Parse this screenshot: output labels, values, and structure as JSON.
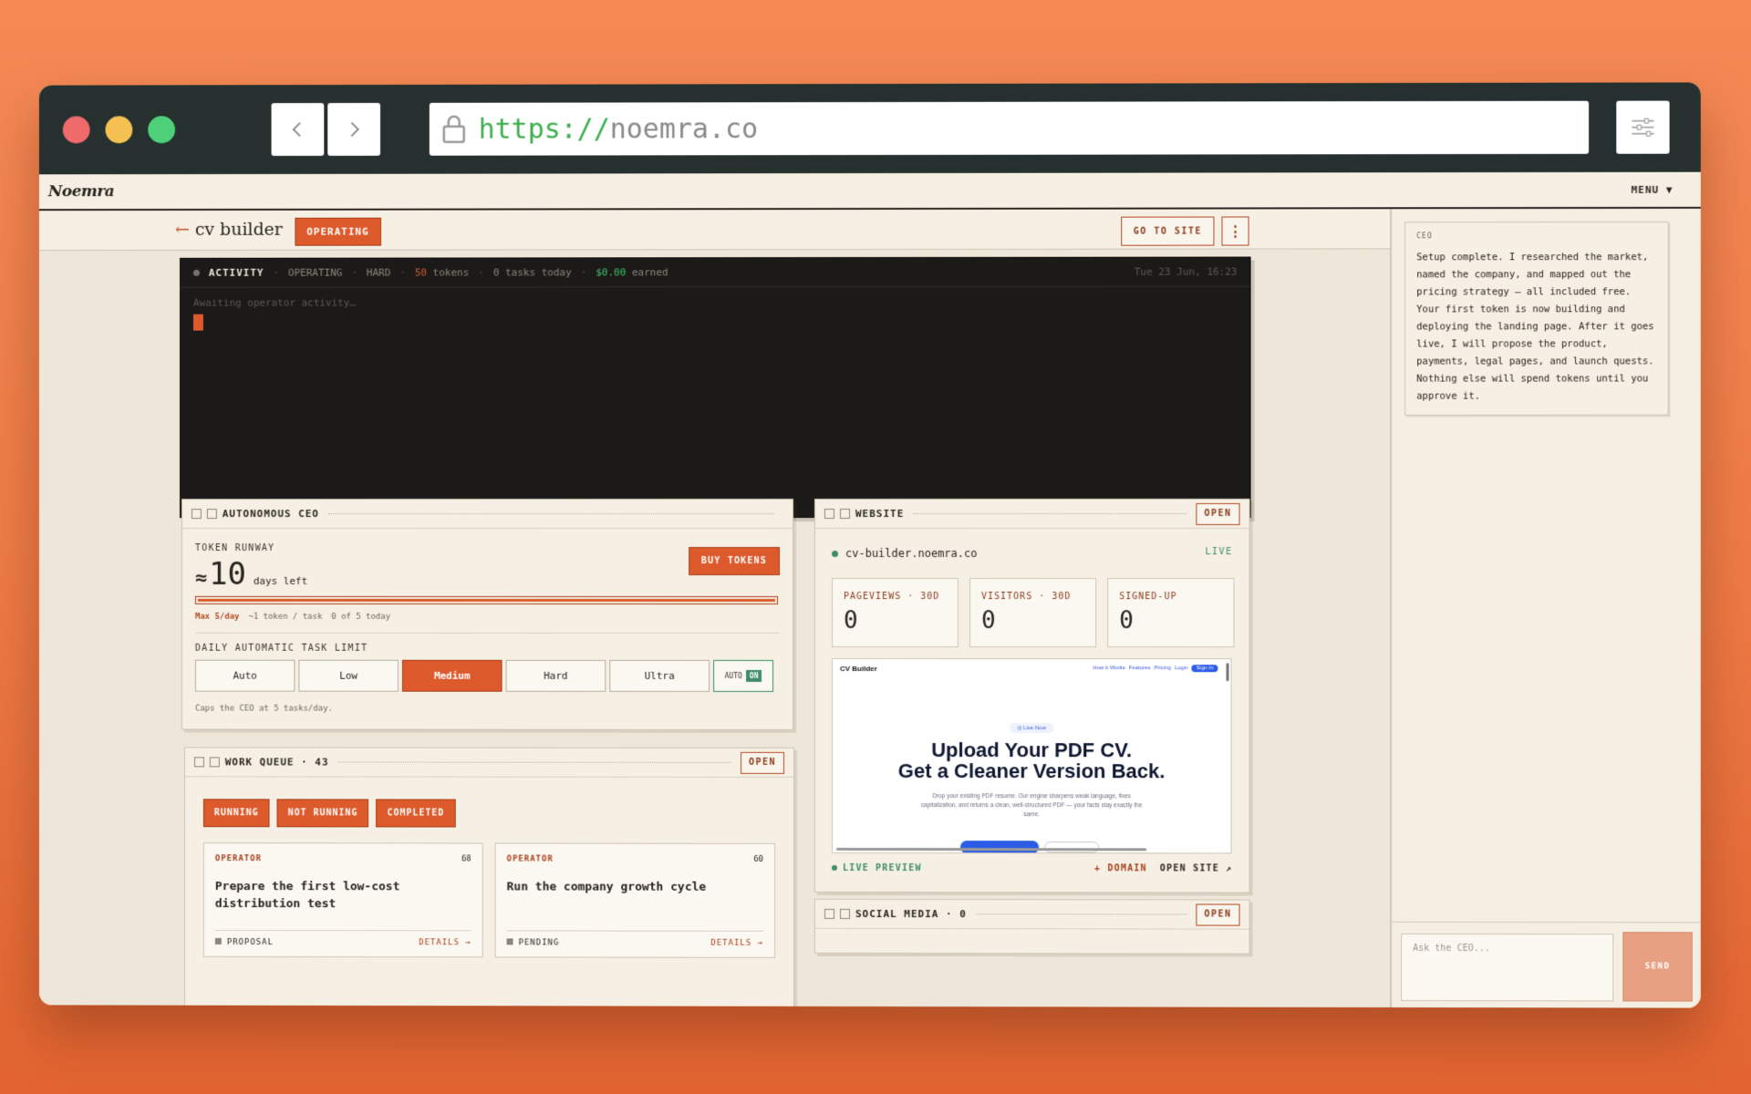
{
  "browser": {
    "url_scheme": "https://",
    "url_host": "noemra.co"
  },
  "app": {
    "brand": "Noemra",
    "menu_label": "MENU ▼"
  },
  "project": {
    "back_arrow": "←",
    "name": "cv builder",
    "status_badge": "OPERATING",
    "goto_label": "GO TO SITE",
    "kebab": "⋮"
  },
  "activity": {
    "label": "ACTIVITY",
    "status": "OPERATING",
    "difficulty": "HARD",
    "tokens_num": "50",
    "tokens_word": "tokens",
    "tasks_today": "0 tasks today",
    "earned_amount": "$0.00",
    "earned_word": "earned",
    "timestamp": "Tue 23 Jun, 16:23",
    "placeholder": "Awaiting operator activity…",
    "sep": "·"
  },
  "ceo_card": {
    "title": "AUTONOMOUS CEO",
    "runway_label": "TOKEN RUNWAY",
    "approx": "≈",
    "runway_value": "10",
    "runway_unit": "days left",
    "buy_label": "BUY TOKENS",
    "runway_fill_percent": 100,
    "max_label": "Max 5/day",
    "per_task": "~1 token / task",
    "today": "0 of 5 today",
    "limit_label": "DAILY AUTOMATIC TASK LIMIT",
    "levels": [
      "Auto",
      "Low",
      "Medium",
      "Hard",
      "Ultra"
    ],
    "active_level": "Medium",
    "auto_label": "AUTO",
    "auto_state": "ON",
    "caps_text": "Caps the CEO at 5 tasks/day."
  },
  "work_queue": {
    "title": "WORK QUEUE · 43",
    "open_label": "OPEN",
    "filters": [
      "RUNNING",
      "NOT RUNNING",
      "COMPLETED"
    ],
    "tasks": [
      {
        "role": "OPERATOR",
        "count": "68",
        "title": "Prepare the first low-cost distribution test",
        "status": "PROPOSAL",
        "details": "DETAILS →"
      },
      {
        "role": "OPERATOR",
        "count": "60",
        "title": "Run the company growth cycle",
        "status": "PENDING",
        "details": "DETAILS →"
      }
    ]
  },
  "website": {
    "title": "WEBSITE",
    "open_label": "OPEN",
    "domain": "cv-builder.noemra.co",
    "live": "LIVE",
    "stats": [
      {
        "label": "PAGEVIEWS · 30D",
        "value": "0"
      },
      {
        "label": "VISITORS · 30D",
        "value": "0"
      },
      {
        "label": "SIGNED-UP",
        "value": "0"
      }
    ],
    "preview": {
      "logo": "CV Builder",
      "nav": [
        "How it Works",
        "Features",
        "Pricing",
        "Login"
      ],
      "nav_cta": "Sign In",
      "badge": "◎ Live Now",
      "headline_1": "Upload Your PDF CV.",
      "headline_2": "Get a Cleaner Version Back.",
      "paragraph": "Drop your existing PDF resume. Our engine sharpens weak language, fixes capitalization, and returns a clean, well-structured PDF — your facts stay exactly the same."
    },
    "live_preview": "LIVE PREVIEW",
    "domain_link": "+ DOMAIN",
    "open_site": "OPEN SITE ↗"
  },
  "social": {
    "title": "SOCIAL MEDIA · 0",
    "open_label": "OPEN"
  },
  "ceo_panel": {
    "who": "CEO",
    "message": "Setup complete. I researched the market, named the company, and mapped out the pricing strategy — all included free. Your first token is now building and deploying the landing page. After it goes live, I will propose the product, payments, legal pages, and launch quests. Nothing else will spend tokens until you approve it.",
    "ask_placeholder": "Ask the CEO...",
    "send_label": "SEND"
  }
}
